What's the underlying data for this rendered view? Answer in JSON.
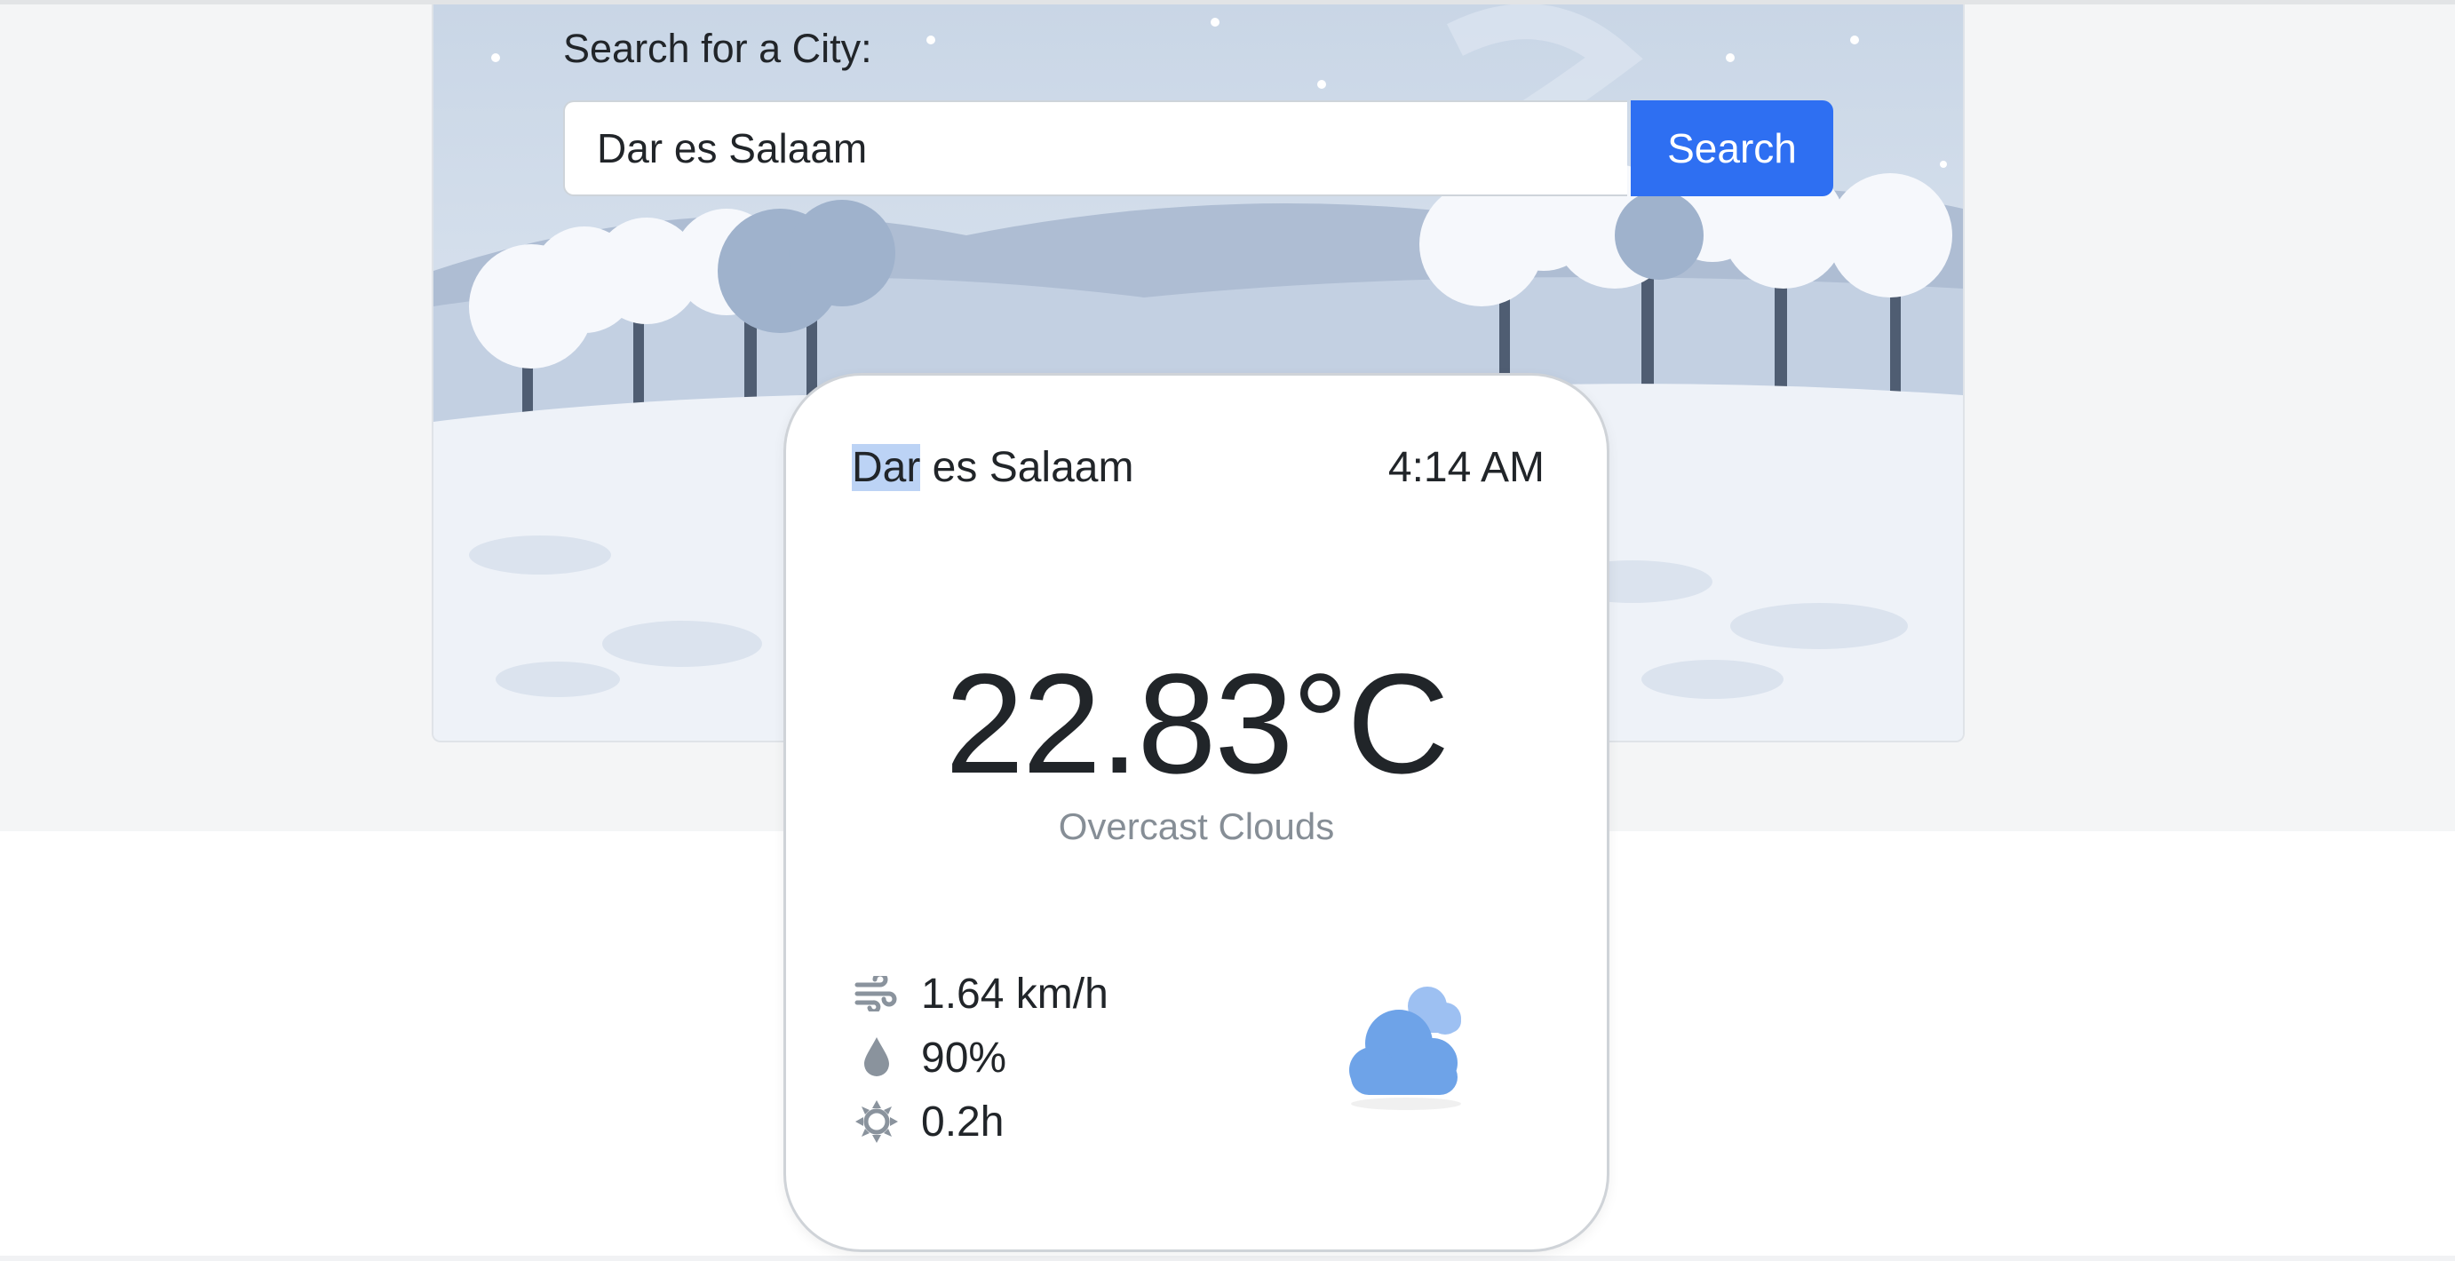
{
  "search": {
    "label": "Search for a City:",
    "input_value": "Dar es Salaam",
    "button_label": "Search"
  },
  "weather": {
    "city_highlight": "Dar",
    "city_rest": " es Salaam",
    "time": "4:14 AM",
    "temperature": "22.83°C",
    "description": "Overcast Clouds",
    "wind": "1.64 km/h",
    "humidity": "90%",
    "sunshine": "0.2h",
    "icons": {
      "wind": "wind-icon",
      "humidity": "droplet-icon",
      "sunshine": "sun-icon",
      "condition": "overcast-clouds-icon"
    }
  },
  "colors": {
    "accent": "#2e6ff2",
    "cloud_front": "#6ea3e8",
    "cloud_back": "#9dc0f2",
    "muted_text": "#868e96"
  }
}
